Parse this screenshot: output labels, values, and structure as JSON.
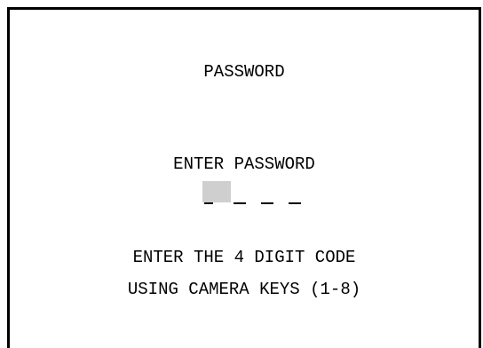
{
  "screen": {
    "title": "PASSWORD",
    "prompt": "ENTER PASSWORD",
    "code_entry": {
      "digits": 4,
      "active_index": 0,
      "entered": [
        "",
        "",
        "",
        ""
      ]
    },
    "instructions": [
      "ENTER THE 4 DIGIT CODE",
      "USING CAMERA KEYS (1-8)"
    ]
  },
  "colors": {
    "background": "#ffffff",
    "text": "#000000",
    "cursor": "#cfcfcf"
  }
}
